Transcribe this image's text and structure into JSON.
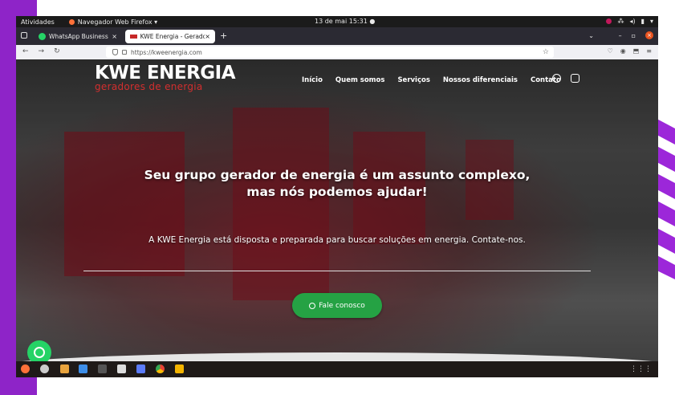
{
  "topbar": {
    "activities": "Atividades",
    "app_menu": "Navegador Web Firefox ▾",
    "clock": "13 de mai  15:31  ●"
  },
  "tabs": [
    {
      "label": "WhatsApp Business",
      "close": "×"
    },
    {
      "label": "KWE Energia - Geradores",
      "close": "×"
    }
  ],
  "browser": {
    "url": "https://kweenergia.com",
    "new_tab": "+",
    "window_minimize": "–",
    "window_maximize": "▫",
    "window_close": "×"
  },
  "site": {
    "logo_main": "KWE ENERGIA",
    "logo_sub": "geradores de energia",
    "nav": [
      "Início",
      "Quem somos",
      "Serviços",
      "Nossos diferenciais",
      "Contato"
    ],
    "headline_line1": "Seu grupo gerador de energia é um assunto complexo,",
    "headline_line2": "mas nós podemos ajudar!",
    "subline": "A KWE Energia está disposta e preparada para buscar soluções em energia. Contate-nos.",
    "cta_label": "Fale conosco"
  },
  "colors": {
    "accent_purple": "#8e24c8",
    "whatsapp_green": "#25d366",
    "brand_red": "#d32f2f"
  },
  "icons": {
    "social": [
      "whatsapp-icon",
      "instagram-icon"
    ],
    "dock": [
      "firefox-icon",
      "settings-icon",
      "files-icon",
      "docs-icon",
      "terminal-icon",
      "window-icon",
      "text-editor-icon",
      "chrome-icon",
      "document-icon"
    ]
  }
}
